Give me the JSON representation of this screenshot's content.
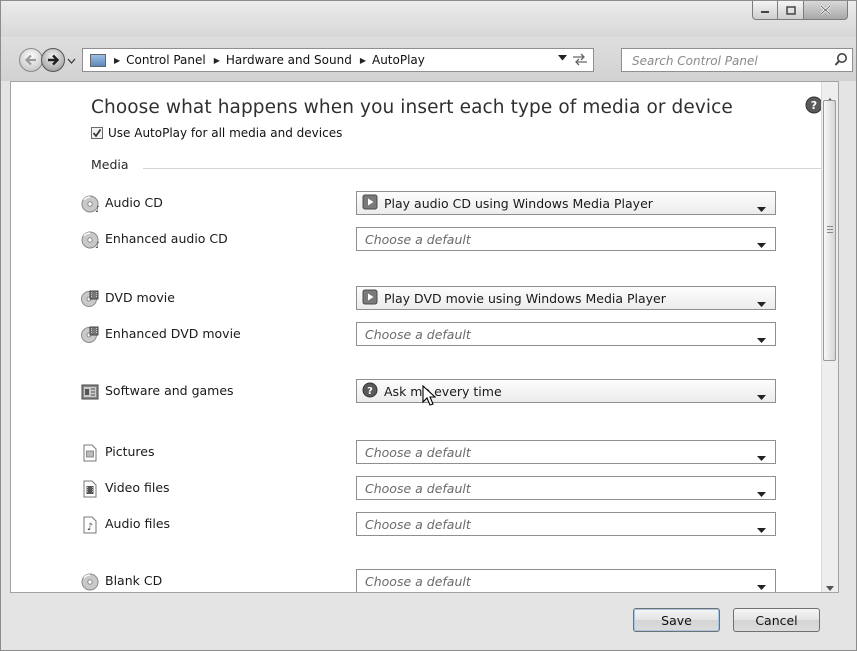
{
  "window": {
    "caption_buttons": [
      "minimize",
      "maximize",
      "close"
    ]
  },
  "address": {
    "breadcrumbs": [
      "Control Panel",
      "Hardware and Sound",
      "AutoPlay"
    ],
    "search_placeholder": "Search Control Panel"
  },
  "main": {
    "heading": "Choose what happens when you insert each type of media or device",
    "use_autoplay": {
      "label": "Use AutoPlay for all media and devices",
      "checked": true
    },
    "section_label": "Media",
    "rows": [
      {
        "label": "Audio CD",
        "icon": "audio-cd-icon",
        "value": "Play audio CD using Windows Media Player",
        "value_icon": "media-player-icon",
        "is_default": false
      },
      {
        "label": "Enhanced audio CD",
        "icon": "enhanced-audio-cd-icon",
        "value": "Choose a default",
        "value_icon": "",
        "is_default": true
      },
      {
        "label": "DVD movie",
        "icon": "dvd-movie-icon",
        "value": "Play DVD movie using Windows Media Player",
        "value_icon": "media-player-icon",
        "is_default": false
      },
      {
        "label": "Enhanced DVD movie",
        "icon": "enhanced-dvd-movie-icon",
        "value": "Choose a default",
        "value_icon": "",
        "is_default": true
      },
      {
        "label": "Software and games",
        "icon": "software-games-icon",
        "value": "Ask me every time",
        "value_icon": "question-icon",
        "is_default": false
      },
      {
        "label": "Pictures",
        "icon": "pictures-icon",
        "value": "Choose a default",
        "value_icon": "",
        "is_default": true
      },
      {
        "label": "Video files",
        "icon": "video-files-icon",
        "value": "Choose a default",
        "value_icon": "",
        "is_default": true
      },
      {
        "label": "Audio files",
        "icon": "audio-files-icon",
        "value": "Choose a default",
        "value_icon": "",
        "is_default": true
      },
      {
        "label": "Blank CD",
        "icon": "blank-cd-icon",
        "value": "Choose a default",
        "value_icon": "",
        "is_default": true
      }
    ]
  },
  "footer": {
    "save_label": "Save",
    "cancel_label": "Cancel"
  }
}
